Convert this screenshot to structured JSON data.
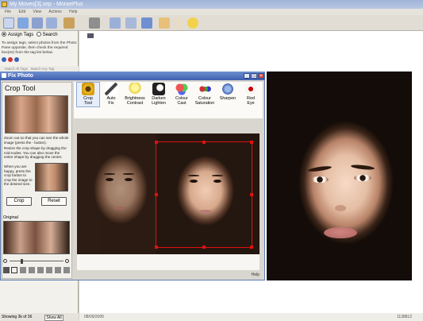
{
  "window": {
    "title": "My Moves[3].sep - MoraePlus"
  },
  "menubar": [
    "File",
    "Edit",
    "View",
    "Actions",
    "Help"
  ],
  "left_pane": {
    "assign_tags_label": "Assign Tags",
    "search_label": "Search",
    "help_text": "To assign tags, select photos from the Photo Pane opposite, then check the required box(es) from the tag list below.",
    "match_all": "Match All Tags",
    "match_any": "Match Any Tag",
    "status_text": "Showing 3k of 36",
    "show_all_label": "Show All"
  },
  "dialog": {
    "title": "Fix Photo",
    "crop_title": "Crop Tool",
    "instruction_1": "Zoom out so that you can see the whole image (press the - button).",
    "instruction_2": "Resize the crop shape by dragging the mid-nodes. You can also move the entire shape by dragging the center.",
    "instruction_3": "When you are happy, press the crop button to crop the image to the desired size.",
    "crop_button": "Crop",
    "reset_button": "Reset",
    "original_label": "Original",
    "help_label": "Help",
    "tools": [
      {
        "label": "Crop\nTool",
        "icon": "crop-sunflower-icon"
      },
      {
        "label": "Auto\nFix",
        "icon": "magic-wand-icon"
      },
      {
        "label": "Brightness\nContrast",
        "icon": "lightbulb-icon"
      },
      {
        "label": "Darken\nLighten",
        "icon": "moon-icon"
      },
      {
        "label": "Colour\nCast",
        "icon": "color-circles-icon"
      },
      {
        "label": "Colour\nSaturation",
        "icon": "saturation-balls-icon"
      },
      {
        "label": "Sharpen",
        "icon": "sharpen-lens-icon"
      },
      {
        "label": "Red\nEye",
        "icon": "red-eye-icon"
      }
    ]
  },
  "status_right": {
    "date": "08/09/2005",
    "info": "1138812"
  },
  "colors": {
    "accent": "#3f5fae",
    "crop_box": "#e01010"
  }
}
